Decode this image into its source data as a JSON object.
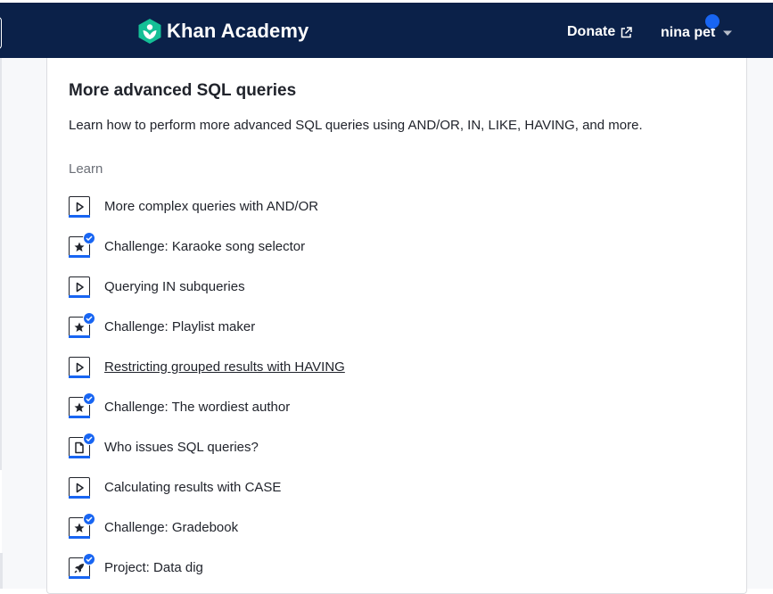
{
  "header": {
    "logo_text": "Khan Academy",
    "donate_label": "Donate",
    "user_name": "nina pet",
    "colors": {
      "nav_bg": "#0b2149",
      "logo_green": "#14bf96",
      "accent": "#1865f2"
    }
  },
  "unit": {
    "title": "More advanced SQL queries",
    "description": "Learn how to perform more advanced SQL queries using AND/OR, IN, LIKE, HAVING, and more.",
    "section_label": "Learn",
    "items": [
      {
        "label": "More complex queries with AND/OR",
        "icon": "video-play-icon",
        "completed": false
      },
      {
        "label": "Challenge: Karaoke song selector",
        "icon": "star-icon",
        "completed": true
      },
      {
        "label": "Querying IN subqueries",
        "icon": "video-play-icon",
        "completed": false
      },
      {
        "label": "Challenge: Playlist maker",
        "icon": "star-icon",
        "completed": true
      },
      {
        "label": "Restricting grouped results with HAVING",
        "icon": "video-play-icon",
        "completed": false
      },
      {
        "label": "Challenge: The wordiest author",
        "icon": "star-icon",
        "completed": true
      },
      {
        "label": "Who issues SQL queries?",
        "icon": "article-icon",
        "completed": true
      },
      {
        "label": "Calculating results with CASE",
        "icon": "video-play-icon",
        "completed": false
      },
      {
        "label": "Challenge: Gradebook",
        "icon": "star-icon",
        "completed": true
      },
      {
        "label": "Project: Data dig",
        "icon": "rocket-icon",
        "completed": true
      }
    ]
  }
}
